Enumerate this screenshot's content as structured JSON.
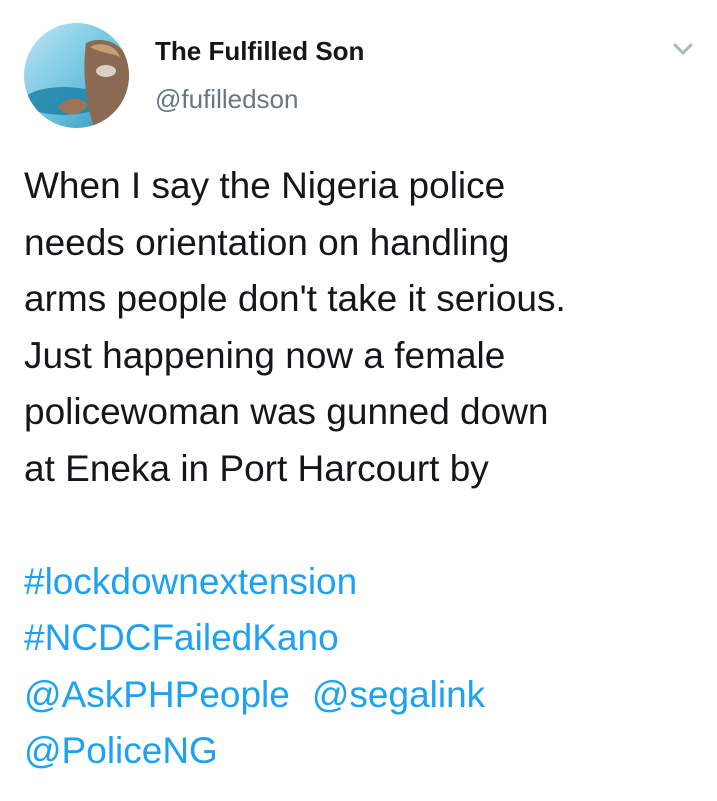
{
  "author": {
    "display_name": "The Fulfilled Son",
    "handle": "@fufilledson",
    "avatar_icon": "profile-photo"
  },
  "menu": {
    "icon": "chevron-down-icon"
  },
  "tweet": {
    "text_lines": [
      "When I say the Nigeria police",
      "needs orientation on handling",
      "arms people don't take it serious.",
      "Just happening now a female",
      "policewoman was gunned down",
      "at Eneka in Port Harcourt by"
    ],
    "hashtags": [
      "#lockdownextension",
      "#NCDCFailedKano"
    ],
    "mentions": [
      "@AskPHPeople",
      "@segalink",
      "@PoliceNG"
    ]
  },
  "colors": {
    "link": "#1da1f2",
    "text": "#14171a",
    "secondary": "#657786"
  }
}
